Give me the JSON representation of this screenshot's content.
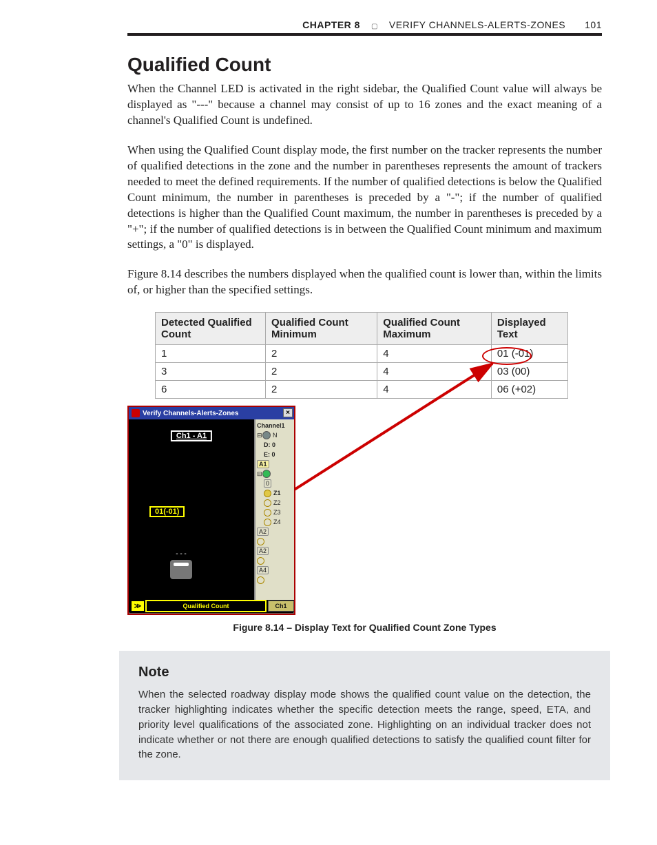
{
  "header": {
    "chapter_label": "CHAPTER 8",
    "section_title": "VERIFY CHANNELS-ALERTS-ZONES",
    "page_number": "101"
  },
  "title": "Qualified Count",
  "paragraphs": {
    "p1": "When the Channel LED is activated in the right sidebar, the Qualified Count value will always be displayed as \"---\" because a channel may consist of up to 16 zones and the exact meaning of a channel's Qualified Count is undefined.",
    "p2": "When using the Qualified Count display mode, the first number on the tracker represents the number of qualified detections in the zone and the number in parentheses represents the amount of trackers needed to meet the defined requirements. If the number of qualified detections is below the Qualified Count minimum, the number in parentheses is preceded by a \"-\"; if the number of qualified detections is higher than the Qualified Count maximum, the number in parentheses is preceded by a \"+\"; if the number of qualified detections is in between the Qualified Count minimum and maximum settings, a \"0\" is displayed.",
    "p3": "Figure 8.14 describes the numbers displayed when the qualified count is lower than, within the limits of, or higher than the specified settings."
  },
  "table": {
    "headers": [
      "Detected Qualified Count",
      "Qualified Count Minimum",
      "Qualified Count Maximum",
      "Displayed Text"
    ],
    "rows": [
      {
        "detected": "1",
        "min": "2",
        "max": "4",
        "text": "01 (-01)"
      },
      {
        "detected": "3",
        "min": "2",
        "max": "4",
        "text": "03 (00)"
      },
      {
        "detected": "6",
        "min": "2",
        "max": "4",
        "text": "06 (+02)"
      }
    ]
  },
  "figure": {
    "caption": "Figure 8.14 – Display Text for Qualified Count Zone Types",
    "window_title": "Verify Channels-Alerts-Zones",
    "close_glyph": "×",
    "ch_header": "Ch1 - A1",
    "counter_label": "01(-01)",
    "bottom_icon": "≫",
    "bottom_label": "Qualified Count",
    "bottom_tab": "Ch1",
    "side": {
      "channel": "Channel1",
      "n": "N",
      "d": "D: 0",
      "e": "E: 0",
      "a1": "A1",
      "qmark": "0",
      "z1": "Z1",
      "z2": "Z2",
      "z3": "Z3",
      "z4": "Z4",
      "a2a": "A2",
      "a2b": "A2",
      "a4": "A4"
    }
  },
  "note": {
    "heading": "Note",
    "body": "When the selected roadway display mode shows the qualified count value on the detection, the tracker highlighting indicates whether the specific detection meets the range, speed, ETA, and priority level qualifications of the associated zone. Highlighting on an individual tracker does not indicate whether or not there are enough qualified detections to satisfy the qualified count filter for the zone."
  }
}
